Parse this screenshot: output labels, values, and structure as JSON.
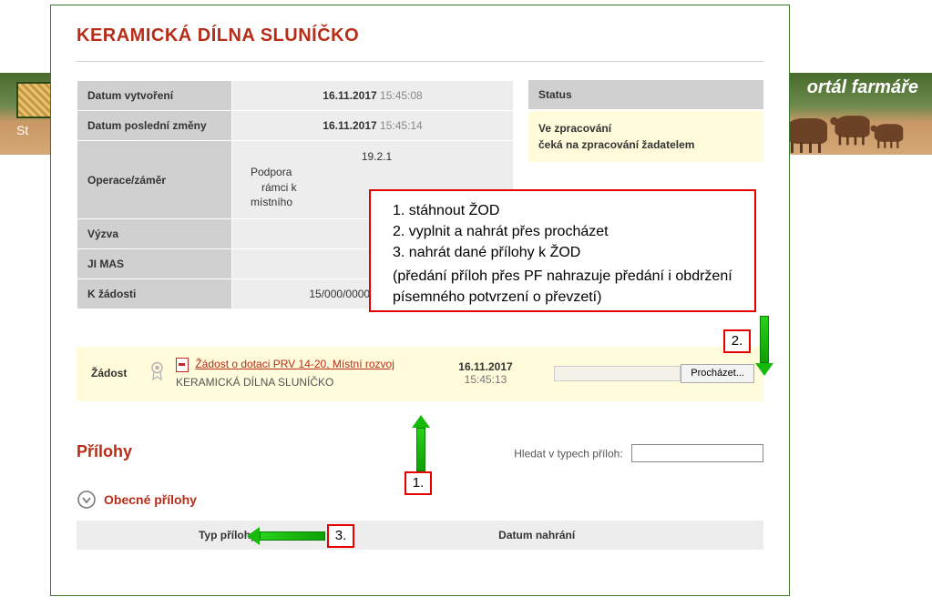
{
  "bg": {
    "left_text": "St",
    "right_text": "ortál farmáře"
  },
  "title": "KERAMICKÁ DÍLNA SLUNÍČKO",
  "meta": {
    "created_label": "Datum vytvoření",
    "created_date": "16.11.2017",
    "created_time": "15:45:08",
    "modified_label": "Datum poslední změny",
    "modified_date": "16.11.2017",
    "modified_time": "15:45:14",
    "operation_label": "Operace/záměr",
    "operation_code": "19.2.1",
    "operation_text_1": "Podpora",
    "operation_text_2": "rámci k",
    "operation_text_3": "místního",
    "vyzva_label": "Výzva",
    "jimas_label": "JI MAS",
    "kzadosti_label": "K žádosti",
    "kzadosti_value": "15/000/00000/671/000114"
  },
  "status": {
    "header": "Status",
    "line1": "Ve zpracování",
    "line2": "čeká na zpracování žadatelem"
  },
  "request": {
    "label": "Žádost",
    "link": "Žádost o dotaci PRV 14-20, Místní rozvoj",
    "sub": "KERAMICKÁ DÍLNA SLUNÍČKO",
    "date": "16.11.2017",
    "time": "15:45:13",
    "browse_btn": "Procházet..."
  },
  "attachments": {
    "heading": "Přílohy",
    "search_label": "Hledat v typech příloh:",
    "section_label": "Obecné přílohy",
    "col1": "Typ přílohy",
    "col2": "Datum nahrání"
  },
  "annotation": {
    "step1": "stáhnout ŽOD",
    "step2": "vyplnit a nahrát přes procházet",
    "step3": "nahrát dané přílohy k ŽOD",
    "note": "(předání příloh přes PF nahrazuje předání i obdržení písemného potvrzení o převzetí)",
    "callout1": "1.",
    "callout2": "2.",
    "callout3": "3."
  }
}
